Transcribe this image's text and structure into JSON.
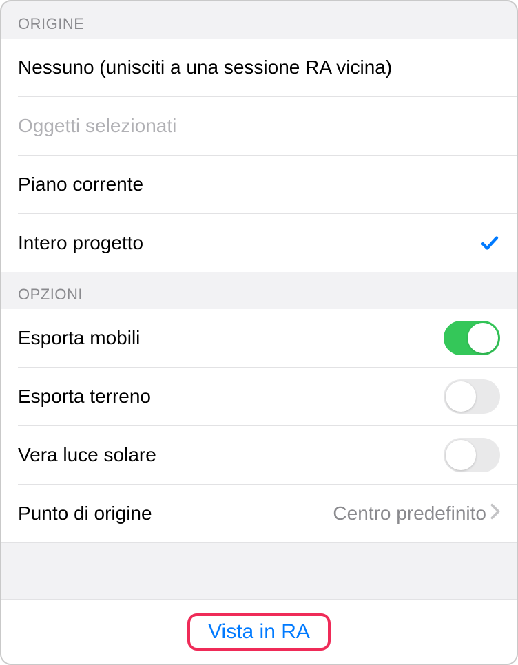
{
  "sections": {
    "origin": {
      "header": "ORIGINE",
      "items": [
        {
          "label": "Nessuno (unisciti a una sessione RA vicina)",
          "disabled": false,
          "selected": false
        },
        {
          "label": "Oggetti selezionati",
          "disabled": true,
          "selected": false
        },
        {
          "label": "Piano corrente",
          "disabled": false,
          "selected": false
        },
        {
          "label": "Intero progetto",
          "disabled": false,
          "selected": true
        }
      ]
    },
    "options": {
      "header": "OPZIONI",
      "toggles": [
        {
          "label": "Esporta mobili",
          "on": true
        },
        {
          "label": "Esporta terreno",
          "on": false
        },
        {
          "label": "Vera luce solare",
          "on": false
        }
      ],
      "nav": {
        "label": "Punto di origine",
        "value": "Centro predefinito"
      }
    }
  },
  "footer": {
    "action_label": "Vista in RA"
  }
}
